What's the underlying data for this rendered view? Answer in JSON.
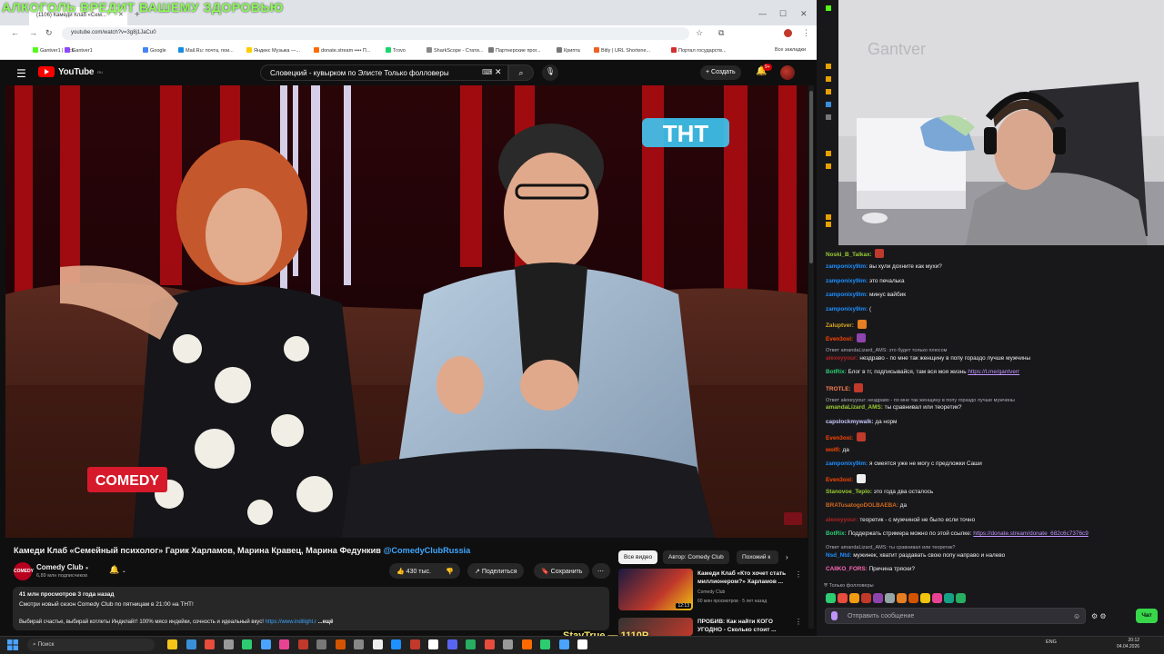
{
  "overlay_text": "АЛКОГОЛЬ ВРЕДИТ ВАШЕМУ ЗДОРОВЬЮ",
  "browser": {
    "tab_title": "(1106) Камеди Клаб «Сем...",
    "url": "youtube.com/watch?v=3g8j1JaCu0",
    "bookmarks": [
      {
        "label": "Gantver1 | Kick",
        "color": "#53fc18"
      },
      {
        "label": "Gantver1",
        "color": "#9146ff"
      },
      {
        "label": "Google",
        "color": "#4285f4"
      },
      {
        "label": "Mail.Ru: почта, пои...",
        "color": "#168de2"
      },
      {
        "label": "Яндекс Музыка —...",
        "color": "#ffcc00"
      },
      {
        "label": "donate.stream •••• П...",
        "color": "#ff6a00"
      },
      {
        "label": "Trovo",
        "color": "#19d66b"
      },
      {
        "label": "SharkScope - Стати...",
        "color": "#888888"
      },
      {
        "label": "Партнерские прог...",
        "color": "#777777"
      },
      {
        "label": "Крипта",
        "color": "#777777"
      },
      {
        "label": "Bitly | URL Shortene...",
        "color": "#ee6123"
      },
      {
        "label": "Портал государств...",
        "color": "#d32f2f"
      }
    ],
    "all_bookmarks": "Все закладки"
  },
  "youtube": {
    "logo": "YouTube",
    "logo_region": "RU",
    "search_value": "Словецкий - кувырком по Элисте   Только фолловеры",
    "create_label": "Создать",
    "notifications": "9+",
    "video_title": "Камеди Клаб «Семейный психолог» Гарик Харламов, Марина Кравец, Марина Федункив",
    "channel_tag": "@ComedyClubRussia",
    "channel": {
      "name": "Comedy Club",
      "subs": "6,89 млн подписчиков",
      "avatar_text": "COMEDY"
    },
    "likes": "430 тыс.",
    "share_label": "Поделиться",
    "save_label": "Сохранить",
    "description": {
      "meta": "41 млн просмотров  3 года назад",
      "line1": "Смотри новый сезон Comedy Club по пятницам в 21:00 на ТНТ!",
      "line2": "Выбирай счастье, выбирай котлеты Индилайт! 100% мясо индейки, сочность и идеальный вкус!",
      "link": "https://www.indilight.r",
      "more": "...ещё"
    },
    "chips": [
      "Все видео",
      "Автор: Comedy Club",
      "Похожий к"
    ],
    "recommendations": [
      {
        "title": "Камеди Клаб «Кто хочет стать миллионером?» Харламов ...",
        "channel": "Comedy Club",
        "meta": "60 млн просмотров · 5 лет назад",
        "duration": "12:13"
      },
      {
        "title": "ПРОБИВ: Как найти КОГО УГОДНО - Сколько стоит ...",
        "channel": "",
        "meta": "",
        "duration": ""
      }
    ],
    "video_watermark": "ТНТ",
    "video_logo": "COMEDY"
  },
  "stream_overlay": "StayTrue — 1110P",
  "chat": {
    "messages": [
      {
        "user": "Noski_B_Talkax:",
        "color": "#9acd32",
        "text": "",
        "emote": "#c0392b"
      },
      {
        "user": "zamponixy9im:",
        "color": "#1e90ff",
        "text": "вы хули дохните как мухи?"
      },
      {
        "user": "zamponixy9im:",
        "color": "#1e90ff",
        "text": "это печалька"
      },
      {
        "user": "zamponixy9im:",
        "color": "#1e90ff",
        "text": "минус вайбик"
      },
      {
        "user": "zamponixy9im:",
        "color": "#1e90ff",
        "text": "("
      },
      {
        "user": "Zaluptver:",
        "color": "#daa520",
        "text": "",
        "emote": "#e67e22"
      },
      {
        "user": "Even3oxi:",
        "color": "#ff4500",
        "text": "",
        "emote": "#8e44ad"
      },
      {
        "reply": "Ответ amandaLizard_AMS: это будет только плюсом"
      },
      {
        "user": "alexeyyour:",
        "color": "#b22222",
        "text": "нездраво - по мне так женщину в попу гораздо лучше мужчины"
      },
      {
        "user": "BotRix:",
        "color": "#2ecc71",
        "text": "Блог в тг, подписывайся, там вся моя жизнь",
        "link": "https://t.me/gantverr"
      },
      {
        "user": "TROTLE:",
        "color": "#ff7f50",
        "text": "",
        "emote": "#c0392b"
      },
      {
        "reply": "Ответ alexeyyour: нездраво - по мне так женщину в попу гораздо лучше мужчины"
      },
      {
        "user": "amandaLizard_AMS:",
        "color": "#9acd32",
        "text": "ты сравнивал или теоретик?"
      },
      {
        "user": "capslockmywalk:",
        "color": "#c9c9ff",
        "text": "да норм"
      },
      {
        "user": "Even3oxi:",
        "color": "#ff4500",
        "text": "",
        "emote": "#c0392b"
      },
      {
        "user": "wolfi:",
        "color": "#ff4500",
        "text": "да"
      },
      {
        "user": "zamponixy9im:",
        "color": "#1e90ff",
        "text": "я смеятся уже не могу с предложки Саши"
      },
      {
        "user": "Even3oxi:",
        "color": "#ff4500",
        "text": "",
        "emote": "#eeeeee"
      },
      {
        "user": "Stanovoe_Teplo:",
        "color": "#9acd32",
        "text": "это года два осталось"
      },
      {
        "user": "BRATusatogoDOLBAEBA:",
        "color": "#d2691e",
        "text": "да"
      },
      {
        "user": "alexeyyour:",
        "color": "#b22222",
        "text": "теоретик - с мужчиной не было если точно"
      },
      {
        "user": "BotRix:",
        "color": "#2ecc71",
        "text": "Поддержать стримера можно по этой ссылке:",
        "link": "https://donate.stream/donate_682c6c7376c9"
      },
      {
        "reply": "Ответ amandaLizard_AMS: ты сравнивал или теоретик?"
      },
      {
        "user": "Nsd_Ntd:",
        "color": "#1e90ff",
        "text": "мужинек, хватит раздавать свою попу направо и налево"
      },
      {
        "user": "CAIIKO_FORS:",
        "color": "#ff69b4",
        "text": "Причина тряски?"
      }
    ],
    "followers_only": "Только фолловеры",
    "input_placeholder": "Отправить сообщение",
    "send_label": "Чат"
  },
  "taskbar": {
    "search_placeholder": "Поиск",
    "tray": "ENG",
    "time": "20:12",
    "date": "04.04.2026"
  }
}
